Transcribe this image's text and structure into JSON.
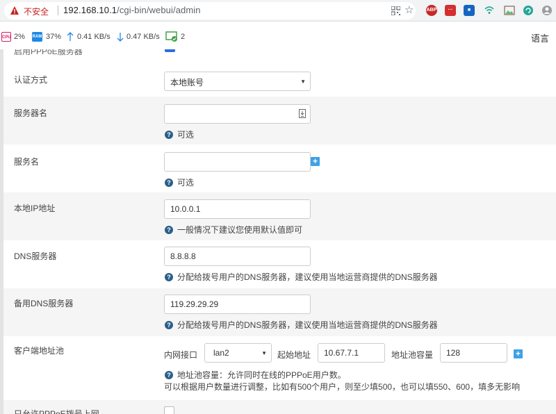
{
  "browser": {
    "security_label": "不安全",
    "url_host": "192.168.10.1",
    "url_path": "/cgi-bin/webui/admin",
    "ext_abp": "ABP"
  },
  "status": {
    "cpu_label": "CPU",
    "cpu": "2%",
    "ram_label": "RAM",
    "ram": "37%",
    "up": "0.41 KB/s",
    "down": "0.47 KB/s",
    "users": "2",
    "language": "语言"
  },
  "form": {
    "top_partial_label": "启用PPPoE服务器",
    "auth": {
      "label": "认证方式",
      "value": "本地账号"
    },
    "server_name": {
      "label": "服务器名",
      "value": "",
      "hint": "可选"
    },
    "service_name": {
      "label": "服务名",
      "value": "",
      "hint": "可选"
    },
    "local_ip": {
      "label": "本地IP地址",
      "value": "10.0.0.1",
      "hint": "一般情况下建议您使用默认值即可"
    },
    "dns": {
      "label": "DNS服务器",
      "value": "8.8.8.8",
      "hint": "分配给拨号用户的DNS服务器，建议使用当地运营商提供的DNS服务器"
    },
    "dns2": {
      "label": "备用DNS服务器",
      "value": "119.29.29.29",
      "hint": "分配给拨号用户的DNS服务器，建议使用当地运营商提供的DNS服务器"
    },
    "pool": {
      "label": "客户端地址池",
      "iface_label": "内网接口",
      "iface_value": "lan2",
      "start_label": "起始地址",
      "start_value": "10.67.7.1",
      "capacity_label": "地址池容量",
      "capacity_value": "128",
      "hint1": "地址池容量：允许同时在线的PPPoE用户数。",
      "hint2": "可以根据用户数量进行调整，比如有500个用户，则至少填500，也可以填550、600，填多无影响"
    },
    "bottom_partial_label": "只允许PPPoE拨号上网"
  },
  "colors": {
    "accent": "#2c5e8a",
    "plus": "#3ea1e6",
    "warning": "#c5221f"
  }
}
